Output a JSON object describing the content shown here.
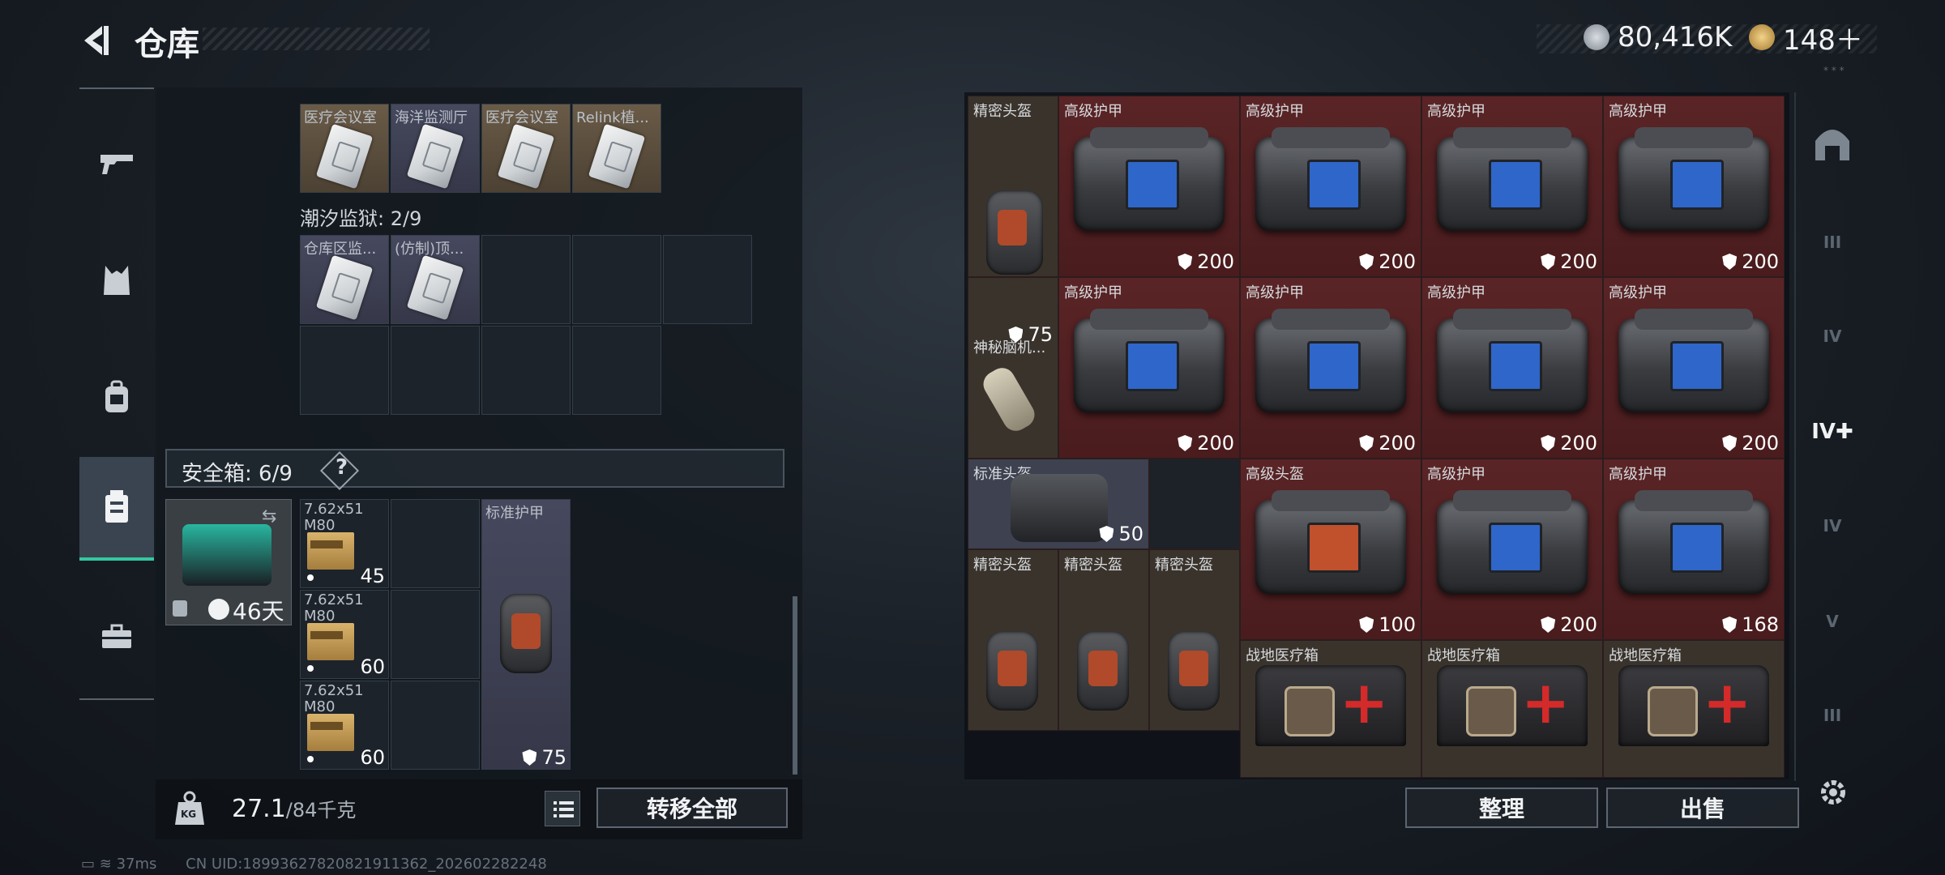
{
  "header": {
    "title": "仓库",
    "currency1": "80,416K",
    "currency2": "148＋",
    "tag": "* * *"
  },
  "left": {
    "row1_labels": [
      "医疗会议室",
      "海洋监测厅",
      "医疗会议室",
      "Relink植..."
    ],
    "section_label": "潮汐监狱: 2/9",
    "row2_labels": [
      "仓库区监...",
      "(仿制)顶..."
    ],
    "safe_label": "安全箱: 6/9",
    "safe_q": "?",
    "safe_days": "46天",
    "ammo": [
      {
        "name": "7.62x51 M80",
        "count": "45"
      },
      {
        "name": "7.62x51 M80",
        "count": "60"
      },
      {
        "name": "7.62x51 M80",
        "count": "60"
      }
    ],
    "std_armor": {
      "label": "标准护甲",
      "dur": "75"
    },
    "weight": "27.1",
    "weight_max": "/84千克",
    "transfer_all": "转移全部",
    "kg_icon": "KG"
  },
  "right": {
    "helm_precise": "精密头盔",
    "brain_item": {
      "label": "神秘脑机...",
      "dur": "75"
    },
    "std_helm": {
      "label": "标准头盔",
      "dur": "50"
    },
    "armor_rows": [
      [
        {
          "label": "高级护甲",
          "dur": "200"
        },
        {
          "label": "高级护甲",
          "dur": "200"
        },
        {
          "label": "高级护甲",
          "dur": "200"
        },
        {
          "label": "高级护甲",
          "dur": "200"
        }
      ],
      [
        {
          "label": "高级护甲",
          "dur": "200"
        },
        {
          "label": "高级护甲",
          "dur": "200"
        },
        {
          "label": "高级护甲",
          "dur": "200"
        },
        {
          "label": "高级护甲",
          "dur": "200"
        }
      ],
      [
        {
          "label": "高级头盔",
          "dur": "100"
        },
        {
          "label": "高级护甲",
          "dur": "200"
        },
        {
          "label": "高级护甲",
          "dur": "168"
        }
      ]
    ],
    "small_helms": [
      "精密头盔",
      "精密头盔",
      "精密头盔"
    ],
    "medkits": [
      "战地医疗箱",
      "战地医疗箱",
      "战地医疗箱"
    ],
    "sort_btn": "整理",
    "sell_btn": "出售",
    "side_tabs": [
      "III",
      "IV",
      "IV",
      "V",
      "III"
    ]
  },
  "status": {
    "ping": "37ms",
    "uid": "CN UID:18993627820821911362_202602282248"
  }
}
